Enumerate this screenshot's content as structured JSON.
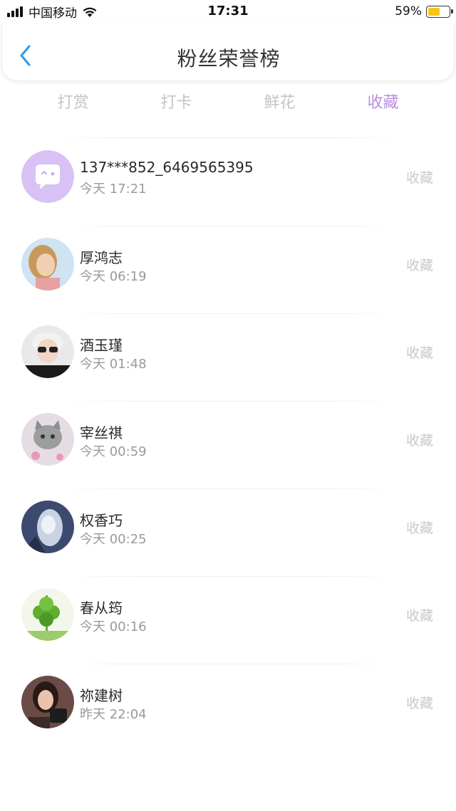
{
  "status_bar": {
    "carrier": "中国移动",
    "time": "17:31",
    "battery": "59%",
    "battery_level": 0.59,
    "battery_color": "#f5c518"
  },
  "header": {
    "back_icon": "chevron-left-icon",
    "title": "粉丝荣誉榜"
  },
  "tabs": [
    {
      "label": "打赏",
      "active": false
    },
    {
      "label": "打卡",
      "active": false
    },
    {
      "label": "鲜花",
      "active": false
    },
    {
      "label": "收藏",
      "active": true
    }
  ],
  "colors": {
    "accent": "#b98fe0",
    "back_icon": "#3a9be0"
  },
  "list": [
    {
      "name": "137***852_6469565395",
      "time": "今天 17:21",
      "action": "收藏"
    },
    {
      "name": "厚鸿志",
      "time": "今天 06:19",
      "action": "收藏"
    },
    {
      "name": "酒玉瑾",
      "time": "今天 01:48",
      "action": "收藏"
    },
    {
      "name": "宰丝祺",
      "time": "今天 00:59",
      "action": "收藏"
    },
    {
      "name": "权香巧",
      "time": "今天 00:25",
      "action": "收藏"
    },
    {
      "name": "春从筠",
      "time": "今天 00:16",
      "action": "收藏"
    },
    {
      "name": "祢建树",
      "time": "昨天 22:04",
      "action": "收藏"
    }
  ]
}
